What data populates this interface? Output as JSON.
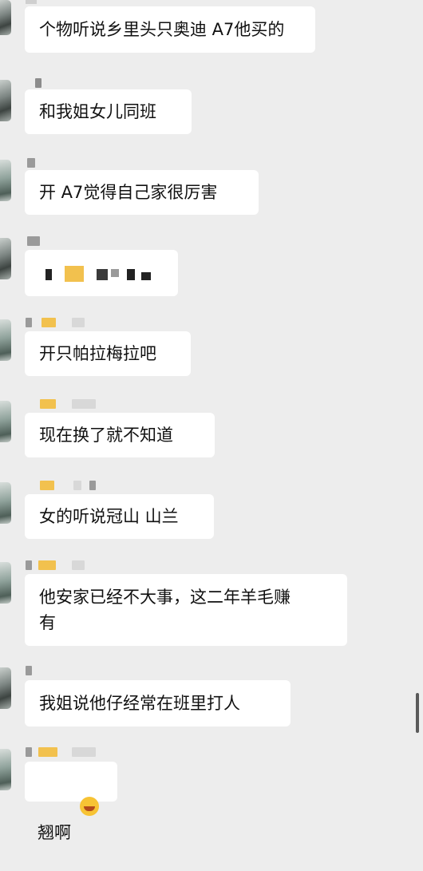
{
  "messages": [
    {
      "text": "个物听说乡里头只奥迪 A7他买的"
    },
    {
      "text": "和我姐女儿同班"
    },
    {
      "text": "开 A7觉得自己家很厉害"
    },
    {
      "text": ""
    },
    {
      "text": "开只帕拉梅拉吧"
    },
    {
      "text": "现在换了就不知道"
    },
    {
      "text": "女的听说冠山 山兰"
    },
    {
      "text": "他安家已经不大事，这二年羊毛赚\n有"
    },
    {
      "text": "我姐说他仔经常在班里打人"
    },
    {
      "text": "翘啊",
      "emoji": "laughing-crying-emoji"
    }
  ],
  "colors": {
    "background": "#ededed",
    "bubble": "#ffffff",
    "pixelated_gold": "#f2c14e"
  }
}
